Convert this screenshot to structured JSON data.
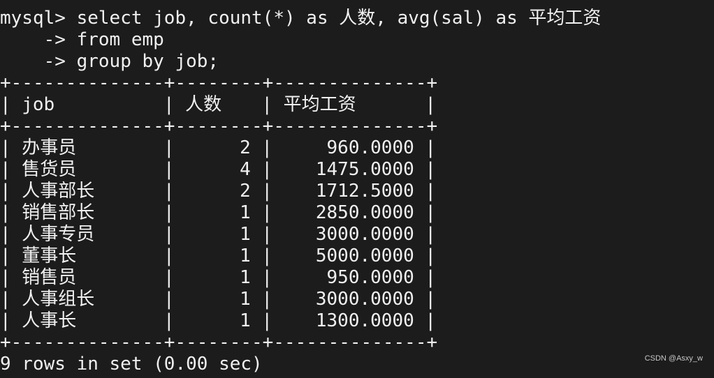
{
  "terminal": {
    "prompt": "mysql> ",
    "continuation_prompt": "    -> ",
    "query_lines": [
      "select job, count(*) as 人数, avg(sal) as 平均工资",
      "from emp",
      "group by job;"
    ],
    "table": {
      "border": "+--------------+--------+--------------+",
      "headers": [
        "job",
        "人数",
        "平均工资"
      ],
      "rows": [
        {
          "job": "办事员",
          "count": "2",
          "avg_sal": "960.0000"
        },
        {
          "job": "售货员",
          "count": "4",
          "avg_sal": "1475.0000"
        },
        {
          "job": "人事部长",
          "count": "2",
          "avg_sal": "1712.5000"
        },
        {
          "job": "销售部长",
          "count": "1",
          "avg_sal": "2850.0000"
        },
        {
          "job": "人事专员",
          "count": "1",
          "avg_sal": "3000.0000"
        },
        {
          "job": "董事长",
          "count": "1",
          "avg_sal": "5000.0000"
        },
        {
          "job": "销售员",
          "count": "1",
          "avg_sal": "950.0000"
        },
        {
          "job": "人事组长",
          "count": "1",
          "avg_sal": "3000.0000"
        },
        {
          "job": "人事长",
          "count": "1",
          "avg_sal": "1300.0000"
        }
      ]
    },
    "result_summary": "9 rows in set (0.00 sec)",
    "pipe": "|"
  },
  "watermark": "CSDN @Asxy_w",
  "colors": {
    "background": "#1c1c1c",
    "foreground": "#f0f0f0"
  }
}
